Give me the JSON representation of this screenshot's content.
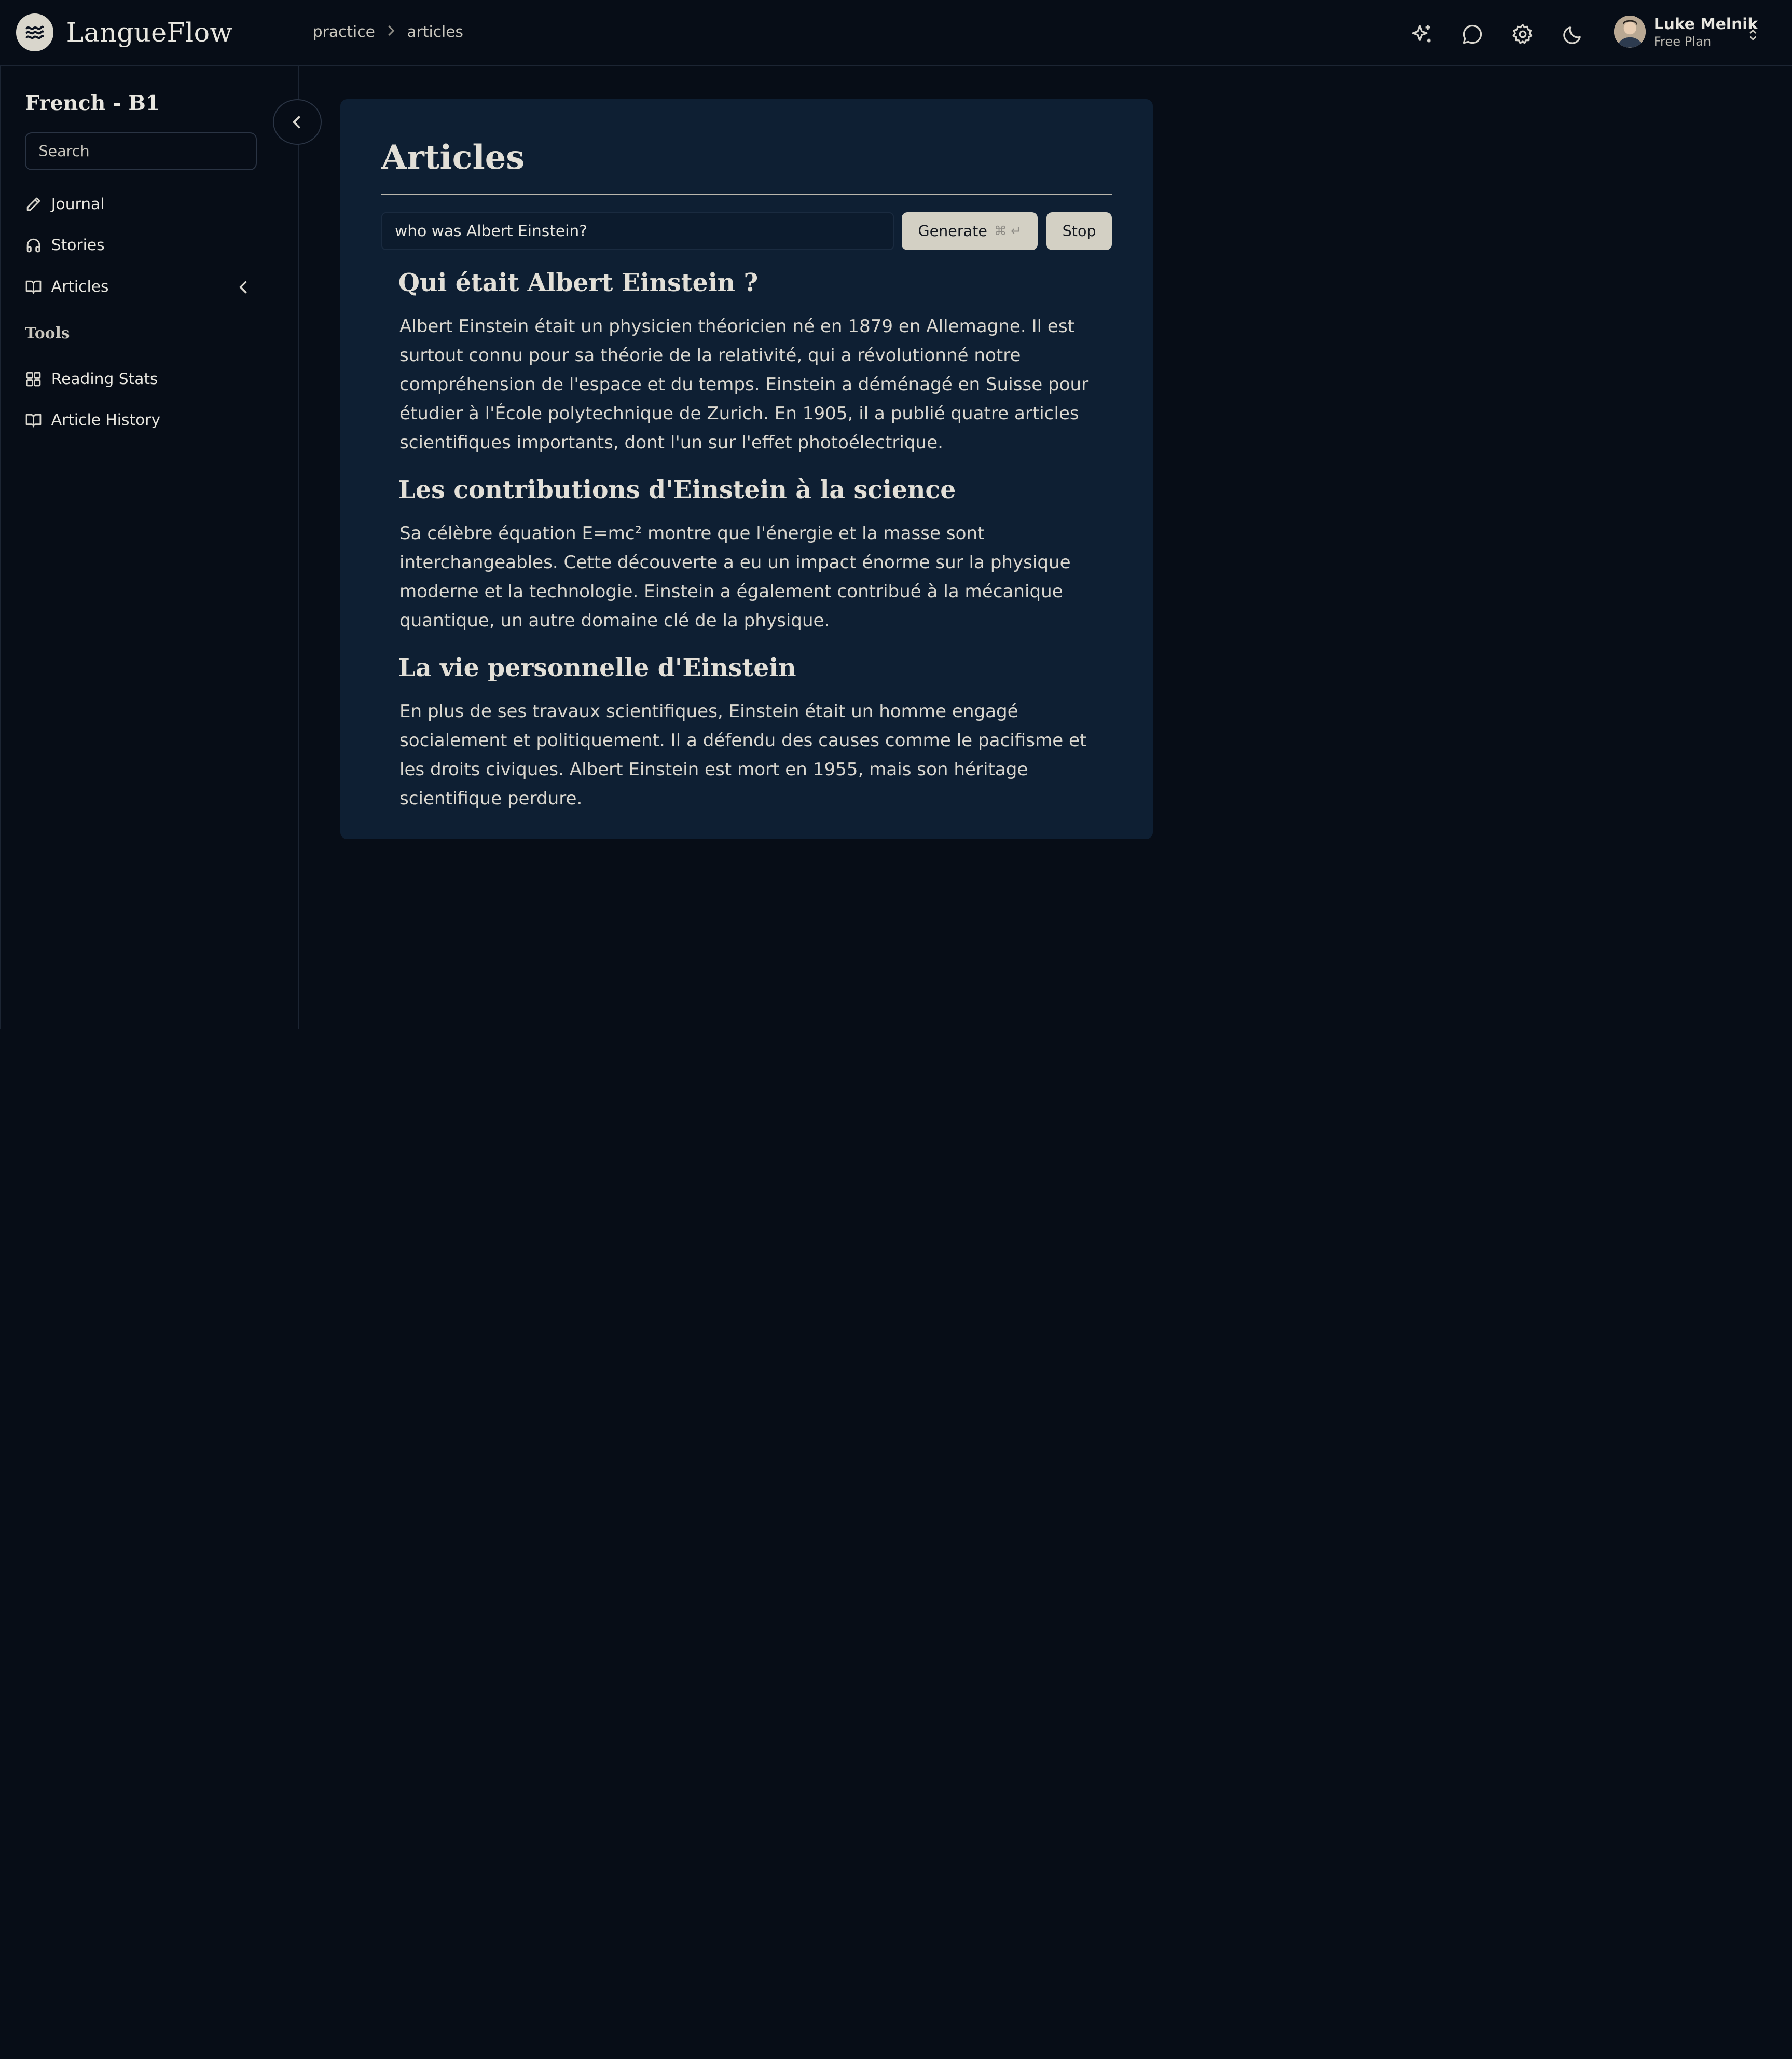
{
  "header": {
    "brand": "LangueFlow",
    "breadcrumb": [
      "practice",
      "articles"
    ],
    "user": {
      "name": "Luke Melnik",
      "plan": "Free Plan"
    }
  },
  "sidebar": {
    "course": "French - B1",
    "search_placeholder": "Search",
    "items": [
      {
        "label": "Journal",
        "icon": "pencil-icon"
      },
      {
        "label": "Stories",
        "icon": "headphones-icon"
      },
      {
        "label": "Articles",
        "icon": "book-open-icon"
      }
    ],
    "tools_label": "Tools",
    "tools": [
      {
        "label": "Reading Stats",
        "icon": "grid-icon"
      },
      {
        "label": "Article History",
        "icon": "book-open-icon"
      }
    ]
  },
  "main": {
    "title": "Articles",
    "query_value": "who was Albert Einstein?",
    "generate_label": "Generate",
    "generate_shortcut": "⌘ ↵",
    "stop_label": "Stop",
    "article": [
      {
        "heading": "Qui était Albert Einstein ?",
        "body": "Albert Einstein était un physicien théoricien né en 1879 en Allemagne.  Il est surtout connu pour sa théorie de la relativité, qui a révolutionné notre compréhension de l'espace et du temps.  Einstein a déménagé en Suisse pour étudier à l'École polytechnique de Zurich.  En 1905, il a publié quatre articles scientifiques importants, dont l'un sur l'effet photoélectrique."
      },
      {
        "heading": "Les contributions d'Einstein à la science",
        "body": "Sa célèbre équation E=mc² montre que l'énergie et la masse sont interchangeables.  Cette découverte a eu un impact énorme sur la physique moderne et la technologie.  Einstein a également contribué à la mécanique quantique, un autre domaine clé de la physique."
      },
      {
        "heading": "La vie personnelle d'Einstein",
        "body": "En plus de ses travaux scientifiques, Einstein était un homme engagé socialement et politiquement.  Il a défendu des causes comme le pacifisme et les droits civiques.  Albert Einstein est mort en 1955, mais son héritage scientifique perdure."
      }
    ]
  },
  "colors": {
    "background": "#070d17",
    "card": "#0e1f33",
    "button": "#d3d0c4",
    "text": "#e8e6df"
  }
}
